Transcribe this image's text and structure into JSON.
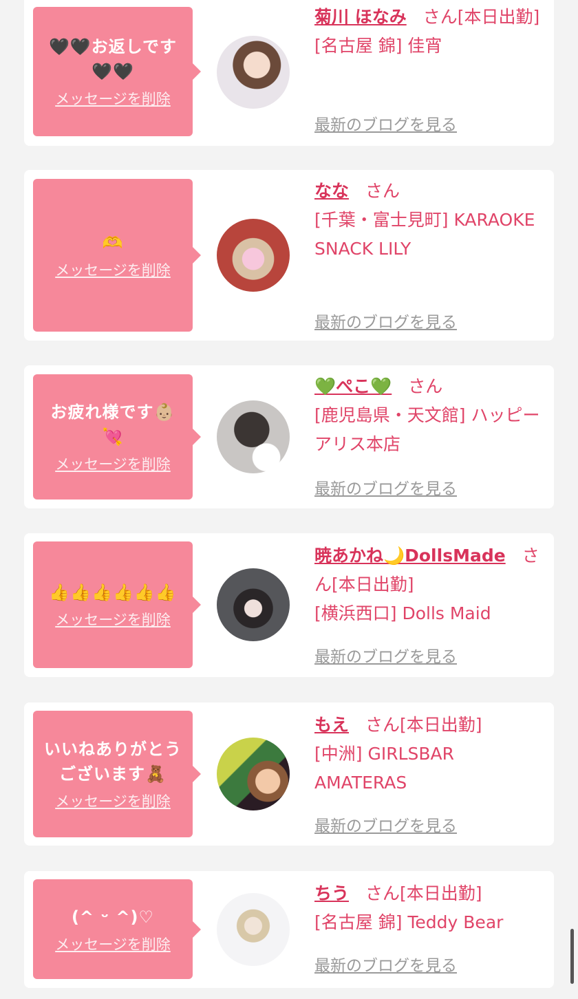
{
  "ui": {
    "delete_label": "メッセージを削除",
    "blog_label": "最新のブログを見る",
    "san": "さん"
  },
  "messages": [
    {
      "message": "🖤🖤お返しです🖤🖤",
      "name": "菊川 ほなみ",
      "suffix": "[本日出勤]",
      "shop": "[名古屋 錦] 佳宵",
      "avatar_icon": "woman-photo"
    },
    {
      "message": "🫶",
      "name": "なな",
      "suffix": "",
      "shop": "[千葉・富士見町] KARAOKE SNACK LILY",
      "avatar_icon": "blurred-face-photo"
    },
    {
      "message": "お疲れ様です👶🏼💘",
      "name": "💚ぺこ💚",
      "suffix": "",
      "shop": "[鹿児島県・天文館] ハッピーアリス本店",
      "avatar_icon": "cat-ears-photo"
    },
    {
      "message": "👍👍👍👍👍👍",
      "name": "暁あかね🌙DollsMade",
      "suffix": "[本日出勤]",
      "shop": "[横浜西口] Dolls Maid",
      "avatar_icon": "gothic-doll-photo"
    },
    {
      "message": "いいねありがとうございます🧸",
      "name": "もえ",
      "suffix": "[本日出勤]",
      "shop": "[中洲] GIRLSBAR AMATERAS",
      "avatar_icon": "selfie-photo"
    },
    {
      "message": "(^ ᵕ ^)♡",
      "name": "ちう",
      "suffix": "[本日出勤]",
      "shop": "[名古屋 錦] Teddy Bear",
      "avatar_icon": "white-hood-photo"
    }
  ]
}
